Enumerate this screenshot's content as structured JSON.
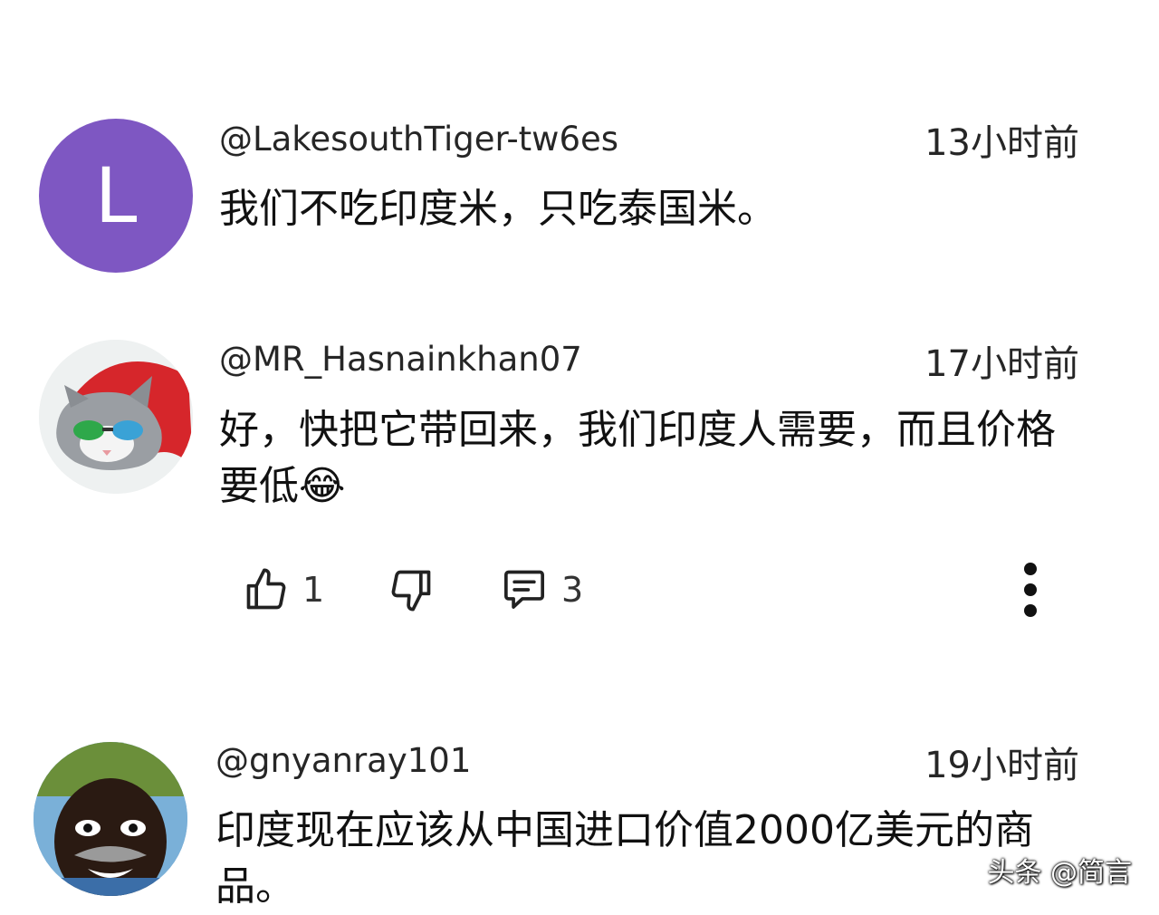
{
  "comments": [
    {
      "avatar_letter": "L",
      "avatar_color": "#7e57c2",
      "username": "@LakesouthTiger-tw6es",
      "time": "13小时前",
      "text": "我们不吃印度米，只吃泰国米。"
    },
    {
      "avatar_icon": "cat-with-sunglasses-avatar",
      "username": "@MR_Hasnainkhan07",
      "time": "17小时前",
      "text": "好，快把它带回来，我们印度人需要，而且价格要低😂",
      "actions": {
        "like_count": "1",
        "reply_count": "3",
        "like_icon": "thumbs-up-icon",
        "dislike_icon": "thumbs-down-icon",
        "reply_icon": "reply-bubble-icon",
        "more_icon": "more-vert-icon"
      }
    },
    {
      "avatar_icon": "man-photo-avatar",
      "username": "@gnyanray101",
      "time": "19小时前",
      "text": "印度现在应该从中国进口价值2000亿美元的商品。"
    }
  ],
  "watermark": "头条 @简言"
}
